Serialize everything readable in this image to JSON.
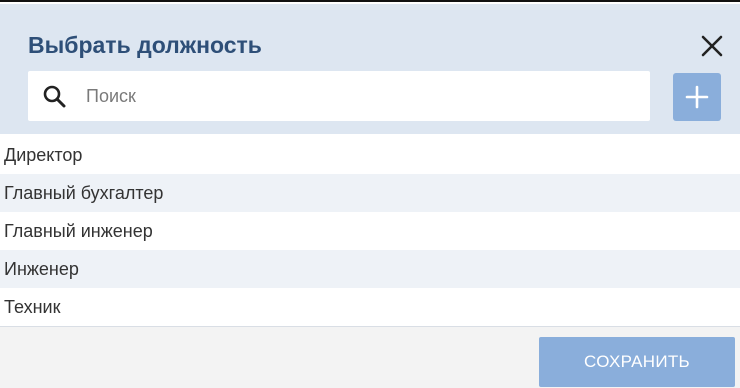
{
  "dialog": {
    "title": "Выбрать должность",
    "close_icon": "close-icon"
  },
  "search": {
    "placeholder": "Поиск",
    "value": "",
    "icon": "search-icon"
  },
  "add_button": {
    "icon": "plus-icon"
  },
  "positions": [
    "Директор",
    "Главный бухгалтер",
    "Главный инженер",
    "Инженер",
    "Техник"
  ],
  "footer": {
    "save_label": "СОХРАНИТЬ"
  },
  "colors": {
    "header_bg": "#dde6f1",
    "title": "#2e4f78",
    "accent_button": "#8aaedb",
    "row_alt": "#eef2f7",
    "footer_bg": "#f3f3f3"
  }
}
